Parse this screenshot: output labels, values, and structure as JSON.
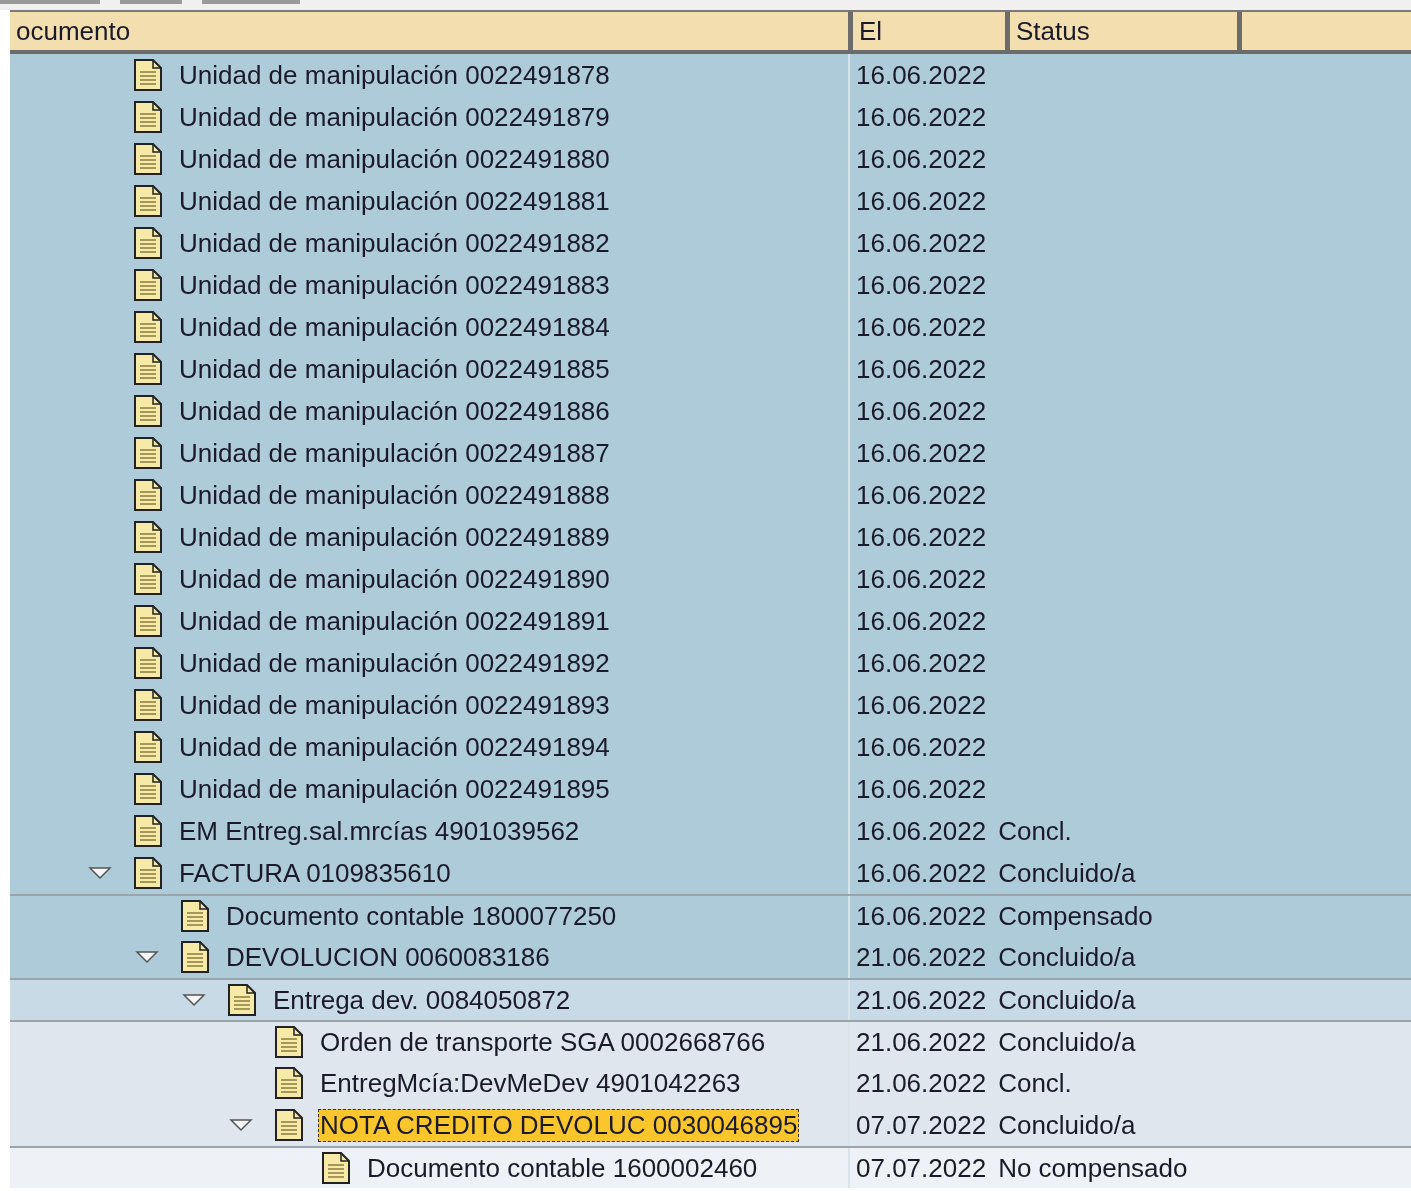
{
  "table": {
    "columns": [
      {
        "label": "ocumento"
      },
      {
        "label": "El"
      },
      {
        "label": "Status"
      }
    ],
    "rows": [
      {
        "label": "Unidad de manipulación 0022491878",
        "date": "16.06.2022",
        "selected": false
      },
      {
        "label": "Unidad de manipulación 0022491879",
        "date": "16.06.2022",
        "selected": false
      },
      {
        "label": "Unidad de manipulación 0022491880",
        "date": "16.06.2022",
        "selected": false
      },
      {
        "label": "Unidad de manipulación 0022491881",
        "date": "16.06.2022",
        "selected": false
      },
      {
        "label": "Unidad de manipulación 0022491882",
        "date": "16.06.2022",
        "selected": false
      },
      {
        "label": "Unidad de manipulación 0022491883",
        "date": "16.06.2022",
        "selected": false
      },
      {
        "label": "Unidad de manipulación 0022491884",
        "date": "16.06.2022",
        "selected": false
      },
      {
        "label": "Unidad de manipulación 0022491885",
        "date": "16.06.2022",
        "selected": false
      },
      {
        "label": "Unidad de manipulación 0022491886",
        "date": "16.06.2022",
        "selected": false
      },
      {
        "label": "Unidad de manipulación 0022491887",
        "date": "16.06.2022",
        "selected": false
      },
      {
        "label": "Unidad de manipulación 0022491888",
        "date": "16.06.2022",
        "selected": false
      },
      {
        "label": "Unidad de manipulación 0022491889",
        "date": "16.06.2022",
        "selected": false
      },
      {
        "label": "Unidad de manipulación 0022491890",
        "date": "16.06.2022",
        "selected": false
      },
      {
        "label": "Unidad de manipulación 0022491891",
        "date": "16.06.2022",
        "selected": false
      },
      {
        "label": "Unidad de manipulación 0022491892",
        "date": "16.06.2022",
        "selected": false
      },
      {
        "label": "Unidad de manipulación 0022491893",
        "date": "16.06.2022",
        "selected": false
      },
      {
        "label": "Unidad de manipulación 0022491894",
        "date": "16.06.2022",
        "selected": false
      },
      {
        "label": "Unidad de manipulación 0022491895",
        "date": "16.06.2022",
        "selected": false
      },
      {
        "label": "EM Entreg.sal.mrcías 4901039562",
        "date": "16.06.2022",
        "status": "Concl.",
        "selected": false
      },
      {
        "label": "FACTURA 0109835610",
        "date": "16.06.2022",
        "status": "Concluido/a",
        "selected": false,
        "expanded": true,
        "children": [
          {
            "label": "Documento contable 1800077250",
            "date": "16.06.2022",
            "status": "Compensado",
            "selected": false
          },
          {
            "label": "DEVOLUCION 0060083186",
            "date": "21.06.2022",
            "status": "Concluido/a",
            "selected": false,
            "expanded": true,
            "children": [
              {
                "label": "Entrega dev. 0084050872",
                "date": "21.06.2022",
                "status": "Concluido/a",
                "selected": false,
                "expanded": true,
                "children": [
                  {
                    "label": "Orden de transporte SGA 0002668766",
                    "date": "21.06.2022",
                    "status": "Concluido/a",
                    "selected": false
                  },
                  {
                    "label": "EntregMcía:DevMeDev 4901042263",
                    "date": "21.06.2022",
                    "status": "Concl.",
                    "selected": false
                  },
                  {
                    "label": "NOTA CREDITO DEVOLUC 0030046895",
                    "date": "07.07.2022",
                    "status": "Concluido/a",
                    "selected": true,
                    "expanded": true,
                    "children": [
                      {
                        "label": "Documento contable 1600002460",
                        "date": "07.07.2022",
                        "status": "No compensado",
                        "selected": false
                      }
                    ]
                  }
                ]
              }
            ]
          }
        ]
      }
    ]
  }
}
